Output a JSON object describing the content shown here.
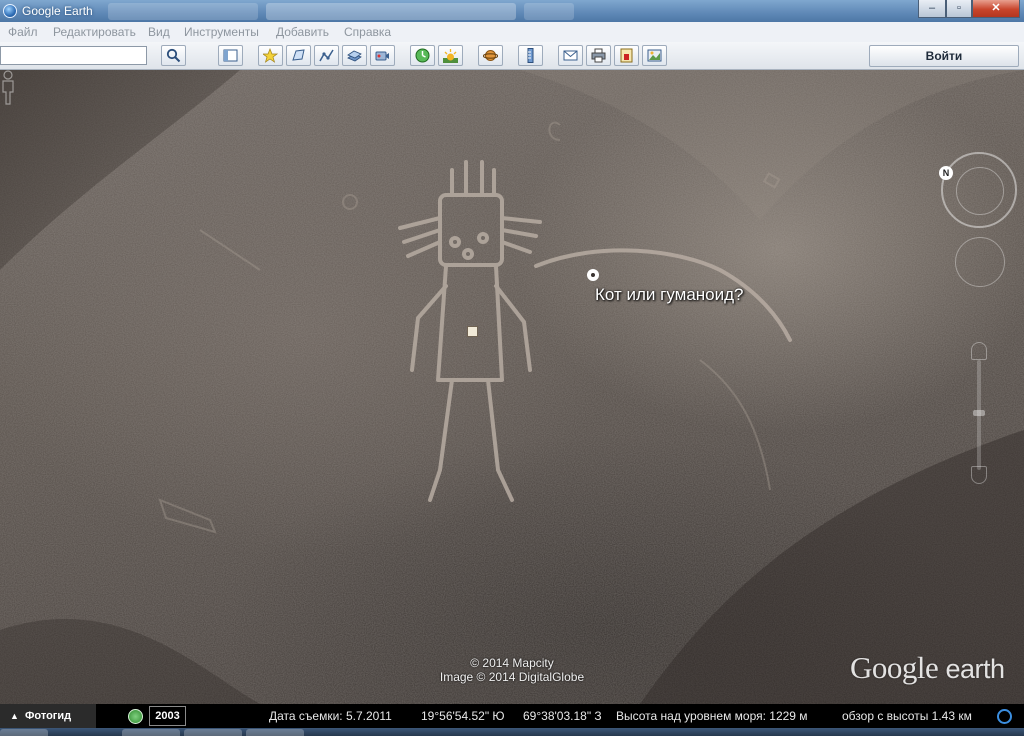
{
  "window": {
    "title": "Google Earth",
    "controls": {
      "minimize": "–",
      "maximize": "▫",
      "close": "✕"
    }
  },
  "menu": [
    {
      "label": "Файл"
    },
    {
      "label": "Редактировать"
    },
    {
      "label": "Вид"
    },
    {
      "label": "Инструменты"
    },
    {
      "label": "Добавить"
    },
    {
      "label": "Справка"
    }
  ],
  "toolbar": {
    "search_value": "",
    "search_button_icon": "search-icon",
    "sign_in_label": "Войти",
    "buttons": [
      {
        "name": "sidebar-toggle",
        "icon": "sidebar-icon"
      },
      {
        "name": "add-placemark",
        "icon": "placemark-icon"
      },
      {
        "name": "add-polygon",
        "icon": "polygon-icon"
      },
      {
        "name": "add-path",
        "icon": "path-icon"
      },
      {
        "name": "add-image-overlay",
        "icon": "image-overlay-icon"
      },
      {
        "name": "record-tour",
        "icon": "record-tour-icon"
      },
      {
        "name": "historical-imagery",
        "icon": "clock-icon"
      },
      {
        "name": "sunlight",
        "icon": "sun-icon"
      },
      {
        "name": "switch-planet",
        "icon": "planet-icon"
      },
      {
        "name": "ruler",
        "icon": "ruler-icon"
      },
      {
        "name": "email",
        "icon": "email-icon"
      },
      {
        "name": "print",
        "icon": "print-icon"
      },
      {
        "name": "save-image",
        "icon": "save-image-icon"
      },
      {
        "name": "view-in-maps",
        "icon": "maps-icon"
      }
    ]
  },
  "map": {
    "placemark_label": "Кот или гуманоид?",
    "copyright_line1": "© 2014 Mapcity",
    "copyright_line2": "Image © 2014 DigitalGlobe",
    "logo_google": "Google",
    "logo_earth": "earth",
    "compass_north": "N"
  },
  "status": {
    "tour_guide_label": "Фотогид",
    "tour_guide_caret": "▲",
    "historical_year": "2003",
    "date_label": "Дата съемки: 5.7.2011",
    "lat": "19°56'54.52\" Ю",
    "lon": "69°38'03.18\" З",
    "elevation": "Высота над уровнем моря:  1229 м",
    "eye_alt": "обзор с высоты    1.43 км"
  },
  "colors": {
    "title_bar": "#5f88b6",
    "menu_text_disabled": "#8e969f",
    "status_bar": "#000000",
    "terrain": "#5a524c"
  }
}
